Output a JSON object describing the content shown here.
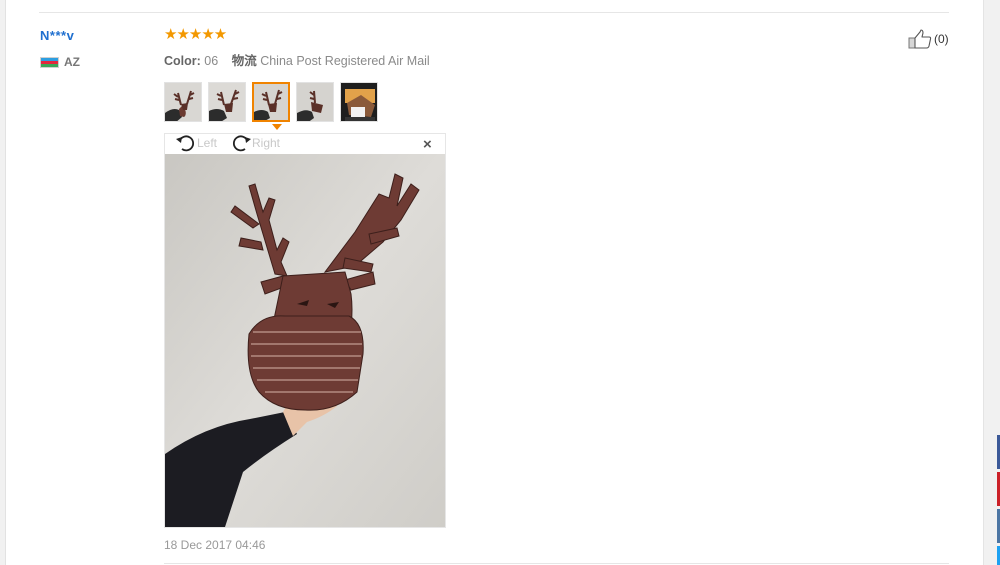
{
  "review": {
    "username": "N***v",
    "country_code": "AZ",
    "rating_stars": "★★★★★",
    "rating": 5,
    "color_label": "Color:",
    "color_value": "06",
    "shipping_label": "物流",
    "shipping_value": "China Post Registered Air Mail",
    "like_count": "(0)",
    "date": "18 Dec 2017 04:46"
  },
  "viewer": {
    "rotate_left": "Left",
    "rotate_right": "Right",
    "close": "×",
    "selected_index": 2
  },
  "thumbnails": [
    "photo-1",
    "photo-2",
    "photo-3",
    "photo-4",
    "photo-5"
  ],
  "icons": {
    "like": "thumbs-up-icon",
    "rotate_left": "rotate-left-icon",
    "rotate_right": "rotate-right-icon",
    "close": "close-icon",
    "flag": "azerbaijan-flag-icon"
  },
  "colors": {
    "username": "#1f6fcf",
    "stars": "#f39800",
    "active_thumb": "#f08300",
    "share_facebook": "#3b5998",
    "share_pinterest": "#cb2027",
    "share_vk": "#4c75a3",
    "share_twitter": "#1da1f2"
  }
}
